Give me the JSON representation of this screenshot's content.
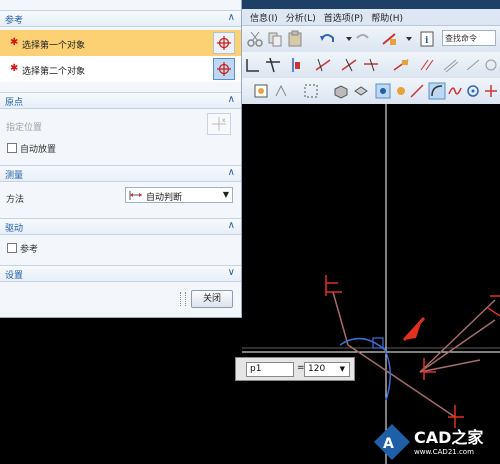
{
  "menu": {
    "items": [
      "信息(I)",
      "分析(L)",
      "首选项(P)",
      "帮助(H)"
    ]
  },
  "toolbar": {
    "search_placeholder": "查找命令"
  },
  "dialog": {
    "sections": {
      "reference": {
        "title": "参考",
        "first_object": "选择第一个对象",
        "second_object": "选择第二个对象"
      },
      "origin": {
        "title": "原点",
        "specify_location": "指定位置",
        "auto_placement": "自动放置"
      },
      "measure": {
        "title": "测量",
        "method_label": "方法",
        "method_value": "自动判断"
      },
      "drive": {
        "title": "驱动",
        "reference_checkbox": "参考"
      },
      "settings": {
        "title": "设置"
      }
    },
    "close_label": "关闭"
  },
  "dimension_input": {
    "name": "p1",
    "equals": "=",
    "value": "120"
  },
  "watermark": {
    "text": "CAD之家",
    "url": "www.CAD21.com"
  },
  "colors": {
    "accent": "#1f5fa8",
    "selection_highlight": "#fbd173",
    "canvas": "#000000",
    "sketch_line": "#a86a6a",
    "dimension": "#3a6fd8",
    "arrow": "#e03020"
  }
}
